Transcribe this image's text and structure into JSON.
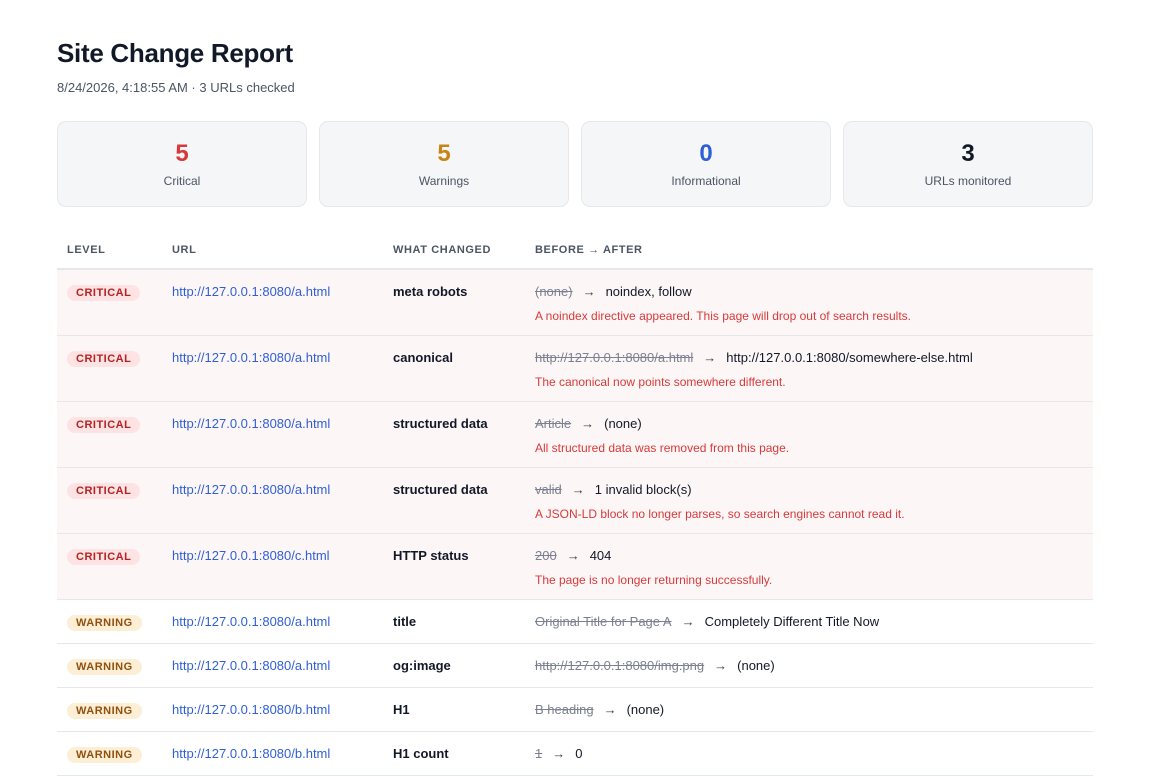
{
  "header": {
    "title": "Site Change Report",
    "subtitle": "8/24/2026, 4:18:55 AM · 3 URLs checked"
  },
  "summary": [
    {
      "value": "5",
      "label": "Critical",
      "color": "#d63a3a"
    },
    {
      "value": "5",
      "label": "Warnings",
      "color": "#c98416"
    },
    {
      "value": "0",
      "label": "Informational",
      "color": "#2f5fd7"
    },
    {
      "value": "3",
      "label": "URLs monitored",
      "color": "#111827"
    }
  ],
  "table": {
    "columns": [
      "LEVEL",
      "URL",
      "WHAT CHANGED",
      "BEFORE → AFTER"
    ],
    "rows": [
      {
        "level": "CRITICAL",
        "url": "http://127.0.0.1:8080/a.html",
        "what": "meta robots",
        "before": "(none)",
        "after": "noindex, follow",
        "note": "A noindex directive appeared. This page will drop out of search results."
      },
      {
        "level": "CRITICAL",
        "url": "http://127.0.0.1:8080/a.html",
        "what": "canonical",
        "before": "http://127.0.0.1:8080/a.html",
        "after": "http://127.0.0.1:8080/somewhere-else.html",
        "note": "The canonical now points somewhere different."
      },
      {
        "level": "CRITICAL",
        "url": "http://127.0.0.1:8080/a.html",
        "what": "structured data",
        "before": "Article",
        "after": "(none)",
        "note": "All structured data was removed from this page."
      },
      {
        "level": "CRITICAL",
        "url": "http://127.0.0.1:8080/a.html",
        "what": "structured data",
        "before": "valid",
        "after": "1 invalid block(s)",
        "note": "A JSON-LD block no longer parses, so search engines cannot read it."
      },
      {
        "level": "CRITICAL",
        "url": "http://127.0.0.1:8080/c.html",
        "what": "HTTP status",
        "before": "200",
        "after": "404",
        "note": "The page is no longer returning successfully."
      },
      {
        "level": "WARNING",
        "url": "http://127.0.0.1:8080/a.html",
        "what": "title",
        "before": "Original Title for Page A",
        "after": "Completely Different Title Now",
        "note": ""
      },
      {
        "level": "WARNING",
        "url": "http://127.0.0.1:8080/a.html",
        "what": "og:image",
        "before": "http://127.0.0.1:8080/img.png",
        "after": "(none)",
        "note": ""
      },
      {
        "level": "WARNING",
        "url": "http://127.0.0.1:8080/b.html",
        "what": "H1",
        "before": "B heading",
        "after": "(none)",
        "note": ""
      },
      {
        "level": "WARNING",
        "url": "http://127.0.0.1:8080/b.html",
        "what": "H1 count",
        "before": "1",
        "after": "0",
        "note": ""
      }
    ],
    "arrow": "→"
  }
}
